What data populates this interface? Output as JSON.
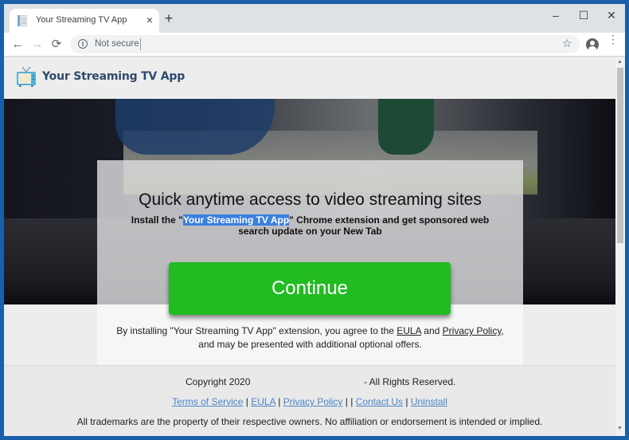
{
  "browser": {
    "tab_title": "Your Streaming TV App",
    "tab_close": "×",
    "new_tab": "+",
    "window_controls": {
      "minimize": "–",
      "maximize": "☐",
      "close": "✕"
    },
    "nav": {
      "back": "←",
      "forward": "→",
      "reload": "⟳"
    },
    "omnibox": {
      "security_label": "Not secure",
      "url": ""
    },
    "icons": {
      "info": "i",
      "star": "☆",
      "menu": "⋮"
    }
  },
  "site": {
    "logo_text": "Your Streaming TV App",
    "headline": "Quick anytime access to video streaming sites",
    "subline": {
      "prefix": "Install the \"",
      "highlight": "Your Streaming TV App",
      "suffix": "\" Chrome extension and get sponsored web search update on your New Tab"
    },
    "continue_label": "Continue",
    "agree": {
      "prefix": "By installing \"Your Streaming TV App\" extension, you agree to the ",
      "eula": "EULA",
      "and": " and ",
      "privacy": "Privacy Policy",
      "suffix": ", and may be presented with additional optional offers."
    }
  },
  "footer": {
    "copyright": "Copyright 2020",
    "rights": "- All Rights Reserved.",
    "links": [
      "Terms of Service",
      "EULA",
      "Privacy Policy",
      "Contact Us",
      "Uninstall"
    ],
    "separators": [
      " | ",
      " | ",
      " | | ",
      " | "
    ],
    "disclaimer": "All trademarks are the property of their respective owners. No affiliation or endorsement is intended or implied."
  },
  "colors": {
    "continue_button": "#22bb22",
    "highlight": "#3b7fe0",
    "logo_text": "#2e4a6b",
    "footer_link": "#4a86c5",
    "window_frame": "#1a5fa8"
  }
}
